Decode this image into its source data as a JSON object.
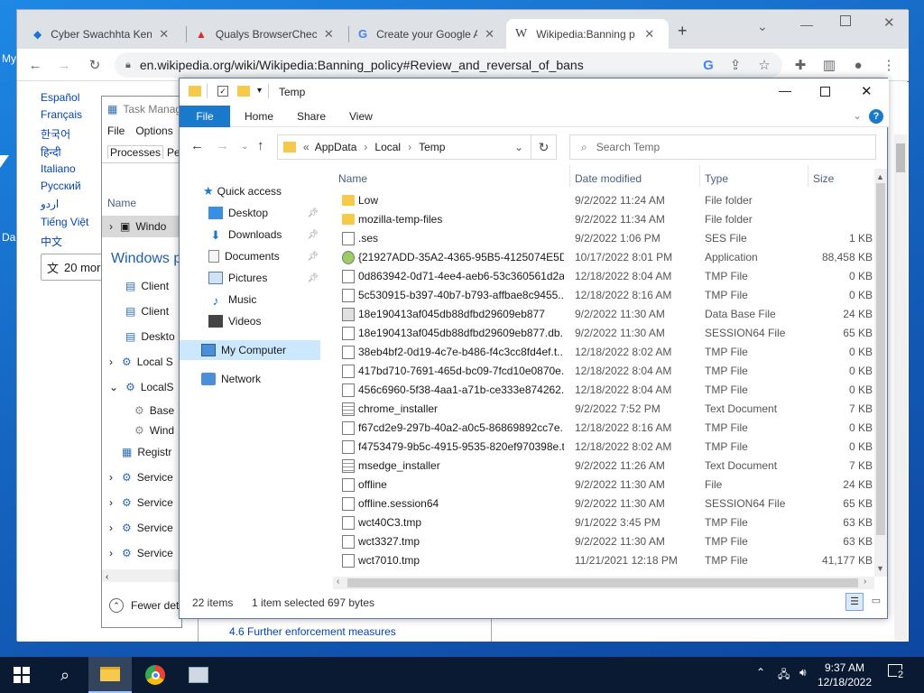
{
  "desktop": {
    "label_top": "My",
    "label_bottom": "Da"
  },
  "browser": {
    "tabs": [
      {
        "title": "Cyber Swachhta Kend",
        "icon": "cyber-swachhta-icon"
      },
      {
        "title": "Qualys BrowserCheck",
        "icon": "qualys-icon"
      },
      {
        "title": "Create your Google A",
        "icon": "google-icon"
      },
      {
        "title": "Wikipedia:Banning p",
        "icon": "wikipedia-icon"
      }
    ],
    "url": "en.wikipedia.org/wiki/Wikipedia:Banning_policy#Review_and_reversal_of_bans",
    "languages": [
      "Español",
      "Français",
      "한국어",
      "हिन्दी",
      "Italiano",
      "Русский",
      "اردو",
      "Tiếng Việt",
      "中文"
    ],
    "more_languages": "20 mor",
    "bottom_text": "4.6 Further enforcement measures"
  },
  "taskmgr": {
    "title": "Task Manag",
    "menu_file": "File",
    "menu_options": "Options",
    "tab_processes": "Processes",
    "tab_perf": "Per",
    "col_name": "Name",
    "rows": [
      "Windo",
      "Windows p",
      "Client",
      "Client",
      "Deskto",
      "Local S",
      "LocalS",
      "Base",
      "Wind",
      "Registr",
      "Service",
      "Service",
      "Service",
      "Service"
    ],
    "fewer_details": "Fewer det"
  },
  "explorer": {
    "title": "Temp",
    "ribbon": {
      "file": "File",
      "home": "Home",
      "share": "Share",
      "view": "View"
    },
    "breadcrumb": {
      "prefix": "«",
      "parts": [
        "AppData",
        "Local",
        "Temp"
      ]
    },
    "search_placeholder": "Search Temp",
    "nav": {
      "quick_access": "Quick access",
      "desktop": "Desktop",
      "downloads": "Downloads",
      "documents": "Documents",
      "pictures": "Pictures",
      "music": "Music",
      "videos": "Videos",
      "my_computer": "My Computer",
      "network": "Network"
    },
    "columns": {
      "name": "Name",
      "date": "Date modified",
      "type": "Type",
      "size": "Size"
    },
    "files": [
      {
        "name": "Low",
        "date": "9/2/2022 11:24 AM",
        "type": "File folder",
        "size": "",
        "icon": "folder"
      },
      {
        "name": "mozilla-temp-files",
        "date": "9/2/2022 11:34 AM",
        "type": "File folder",
        "size": "",
        "icon": "folder"
      },
      {
        "name": ".ses",
        "date": "9/2/2022 1:06 PM",
        "type": "SES File",
        "size": "1 KB",
        "icon": "doc"
      },
      {
        "name": "{21927ADD-35A2-4365-95B5-4125074E5D...",
        "date": "10/17/2022 8:01 PM",
        "type": "Application",
        "size": "88,458 KB",
        "icon": "app"
      },
      {
        "name": "0d863942-0d71-4ee4-aeb6-53c360561d2a...",
        "date": "12/18/2022 8:04 AM",
        "type": "TMP File",
        "size": "0 KB",
        "icon": "doc"
      },
      {
        "name": "5c530915-b397-40b7-b793-affbae8c9455...",
        "date": "12/18/2022 8:16 AM",
        "type": "TMP File",
        "size": "0 KB",
        "icon": "doc"
      },
      {
        "name": "18e190413af045db88dfbd29609eb877",
        "date": "9/2/2022 11:30 AM",
        "type": "Data Base File",
        "size": "24 KB",
        "icon": "db"
      },
      {
        "name": "18e190413af045db88dfbd29609eb877.db....",
        "date": "9/2/2022 11:30 AM",
        "type": "SESSION64 File",
        "size": "65 KB",
        "icon": "doc"
      },
      {
        "name": "38eb4bf2-0d19-4c7e-b486-f4c3cc8fd4ef.t...",
        "date": "12/18/2022 8:02 AM",
        "type": "TMP File",
        "size": "0 KB",
        "icon": "doc"
      },
      {
        "name": "417bd710-7691-465d-bc09-7fcd10e0870e....",
        "date": "12/18/2022 8:04 AM",
        "type": "TMP File",
        "size": "0 KB",
        "icon": "doc"
      },
      {
        "name": "456c6960-5f38-4aa1-a71b-ce333e874262....",
        "date": "12/18/2022 8:04 AM",
        "type": "TMP File",
        "size": "0 KB",
        "icon": "doc"
      },
      {
        "name": "chrome_installer",
        "date": "9/2/2022 7:52 PM",
        "type": "Text Document",
        "size": "7 KB",
        "icon": "txt"
      },
      {
        "name": "f67cd2e9-297b-40a2-a0c5-86869892cc7e....",
        "date": "12/18/2022 8:16 AM",
        "type": "TMP File",
        "size": "0 KB",
        "icon": "doc"
      },
      {
        "name": "f4753479-9b5c-4915-9535-820ef970398e.t...",
        "date": "12/18/2022 8:02 AM",
        "type": "TMP File",
        "size": "0 KB",
        "icon": "doc"
      },
      {
        "name": "msedge_installer",
        "date": "9/2/2022 11:26 AM",
        "type": "Text Document",
        "size": "7 KB",
        "icon": "txt"
      },
      {
        "name": "offline",
        "date": "9/2/2022 11:30 AM",
        "type": "File",
        "size": "24 KB",
        "icon": "doc"
      },
      {
        "name": "offline.session64",
        "date": "9/2/2022 11:30 AM",
        "type": "SESSION64 File",
        "size": "65 KB",
        "icon": "doc"
      },
      {
        "name": "wct40C3.tmp",
        "date": "9/1/2022 3:45 PM",
        "type": "TMP File",
        "size": "63 KB",
        "icon": "doc"
      },
      {
        "name": "wct3327.tmp",
        "date": "9/2/2022 11:30 AM",
        "type": "TMP File",
        "size": "63 KB",
        "icon": "doc"
      },
      {
        "name": "wct7010.tmp",
        "date": "11/21/2021 12:18 PM",
        "type": "TMP File",
        "size": "41,177 KB",
        "icon": "doc"
      }
    ],
    "status": {
      "items": "22 items",
      "selected": "1 item selected",
      "size": "697 bytes"
    }
  },
  "taskbar": {
    "time": "9:37 AM",
    "date": "12/18/2022",
    "notifications": "2"
  }
}
